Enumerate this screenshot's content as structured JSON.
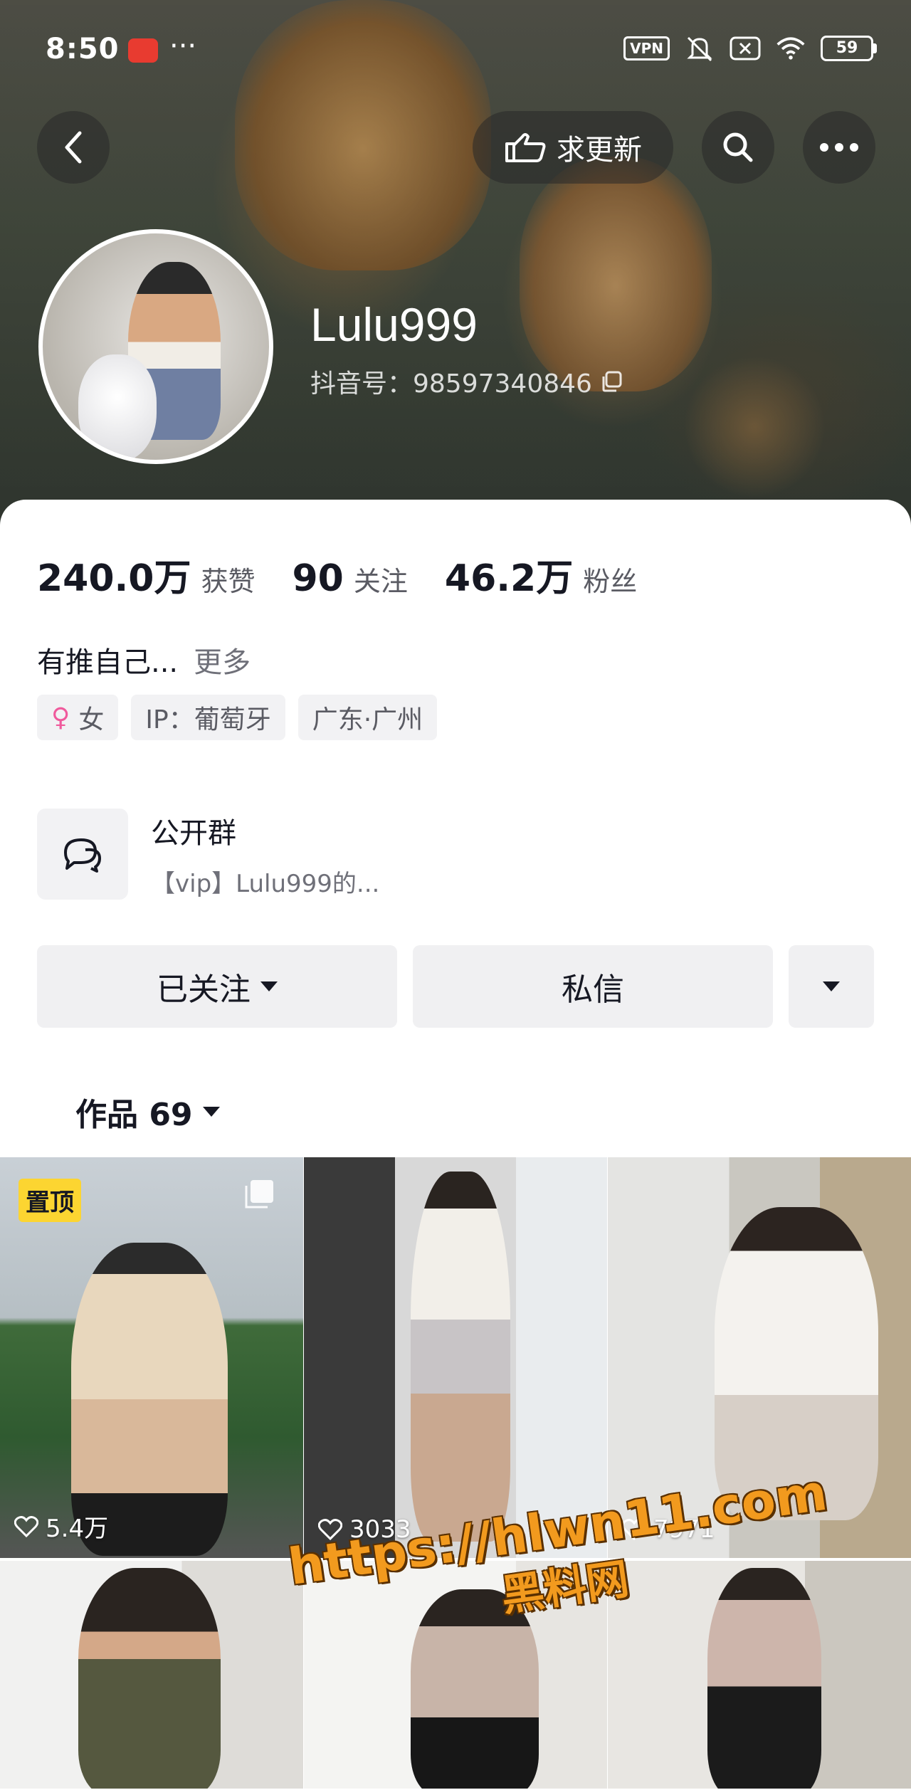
{
  "status": {
    "time": "8:50",
    "dots": "···",
    "vpn": "VPN",
    "battery": "59"
  },
  "nav": {
    "update_label": "求更新"
  },
  "profile": {
    "username": "Lulu999",
    "douyin_id": "抖音号：98597340846"
  },
  "stats": [
    {
      "value": "240.0万",
      "label": "获赞"
    },
    {
      "value": "90",
      "label": "关注"
    },
    {
      "value": "46.2万",
      "label": "粉丝"
    }
  ],
  "bio": {
    "text": "有推自己...",
    "more": "更多"
  },
  "tags": [
    {
      "icon": "female-icon",
      "label": "女"
    },
    {
      "label": "IP：葡萄牙"
    },
    {
      "label": "广东·广州"
    }
  ],
  "group": {
    "title": "公开群",
    "subtitle": "【vip】Lulu999的..."
  },
  "actions": {
    "follow": "已关注",
    "message": "私信"
  },
  "works": {
    "label": "作品 69"
  },
  "videos": [
    {
      "pinned": "置顶",
      "likes": "5.4万"
    },
    {
      "likes": "3033"
    },
    {
      "likes": "7971"
    },
    {
      "likes": ""
    },
    {
      "likes": ""
    },
    {
      "likes": ""
    }
  ],
  "watermark": {
    "url": "https://hlwn11.com",
    "name": "黑料网"
  },
  "colors": {
    "accent_pin": "#fcd531",
    "female": "#f05a9c",
    "watermark": "#f29a1e"
  }
}
